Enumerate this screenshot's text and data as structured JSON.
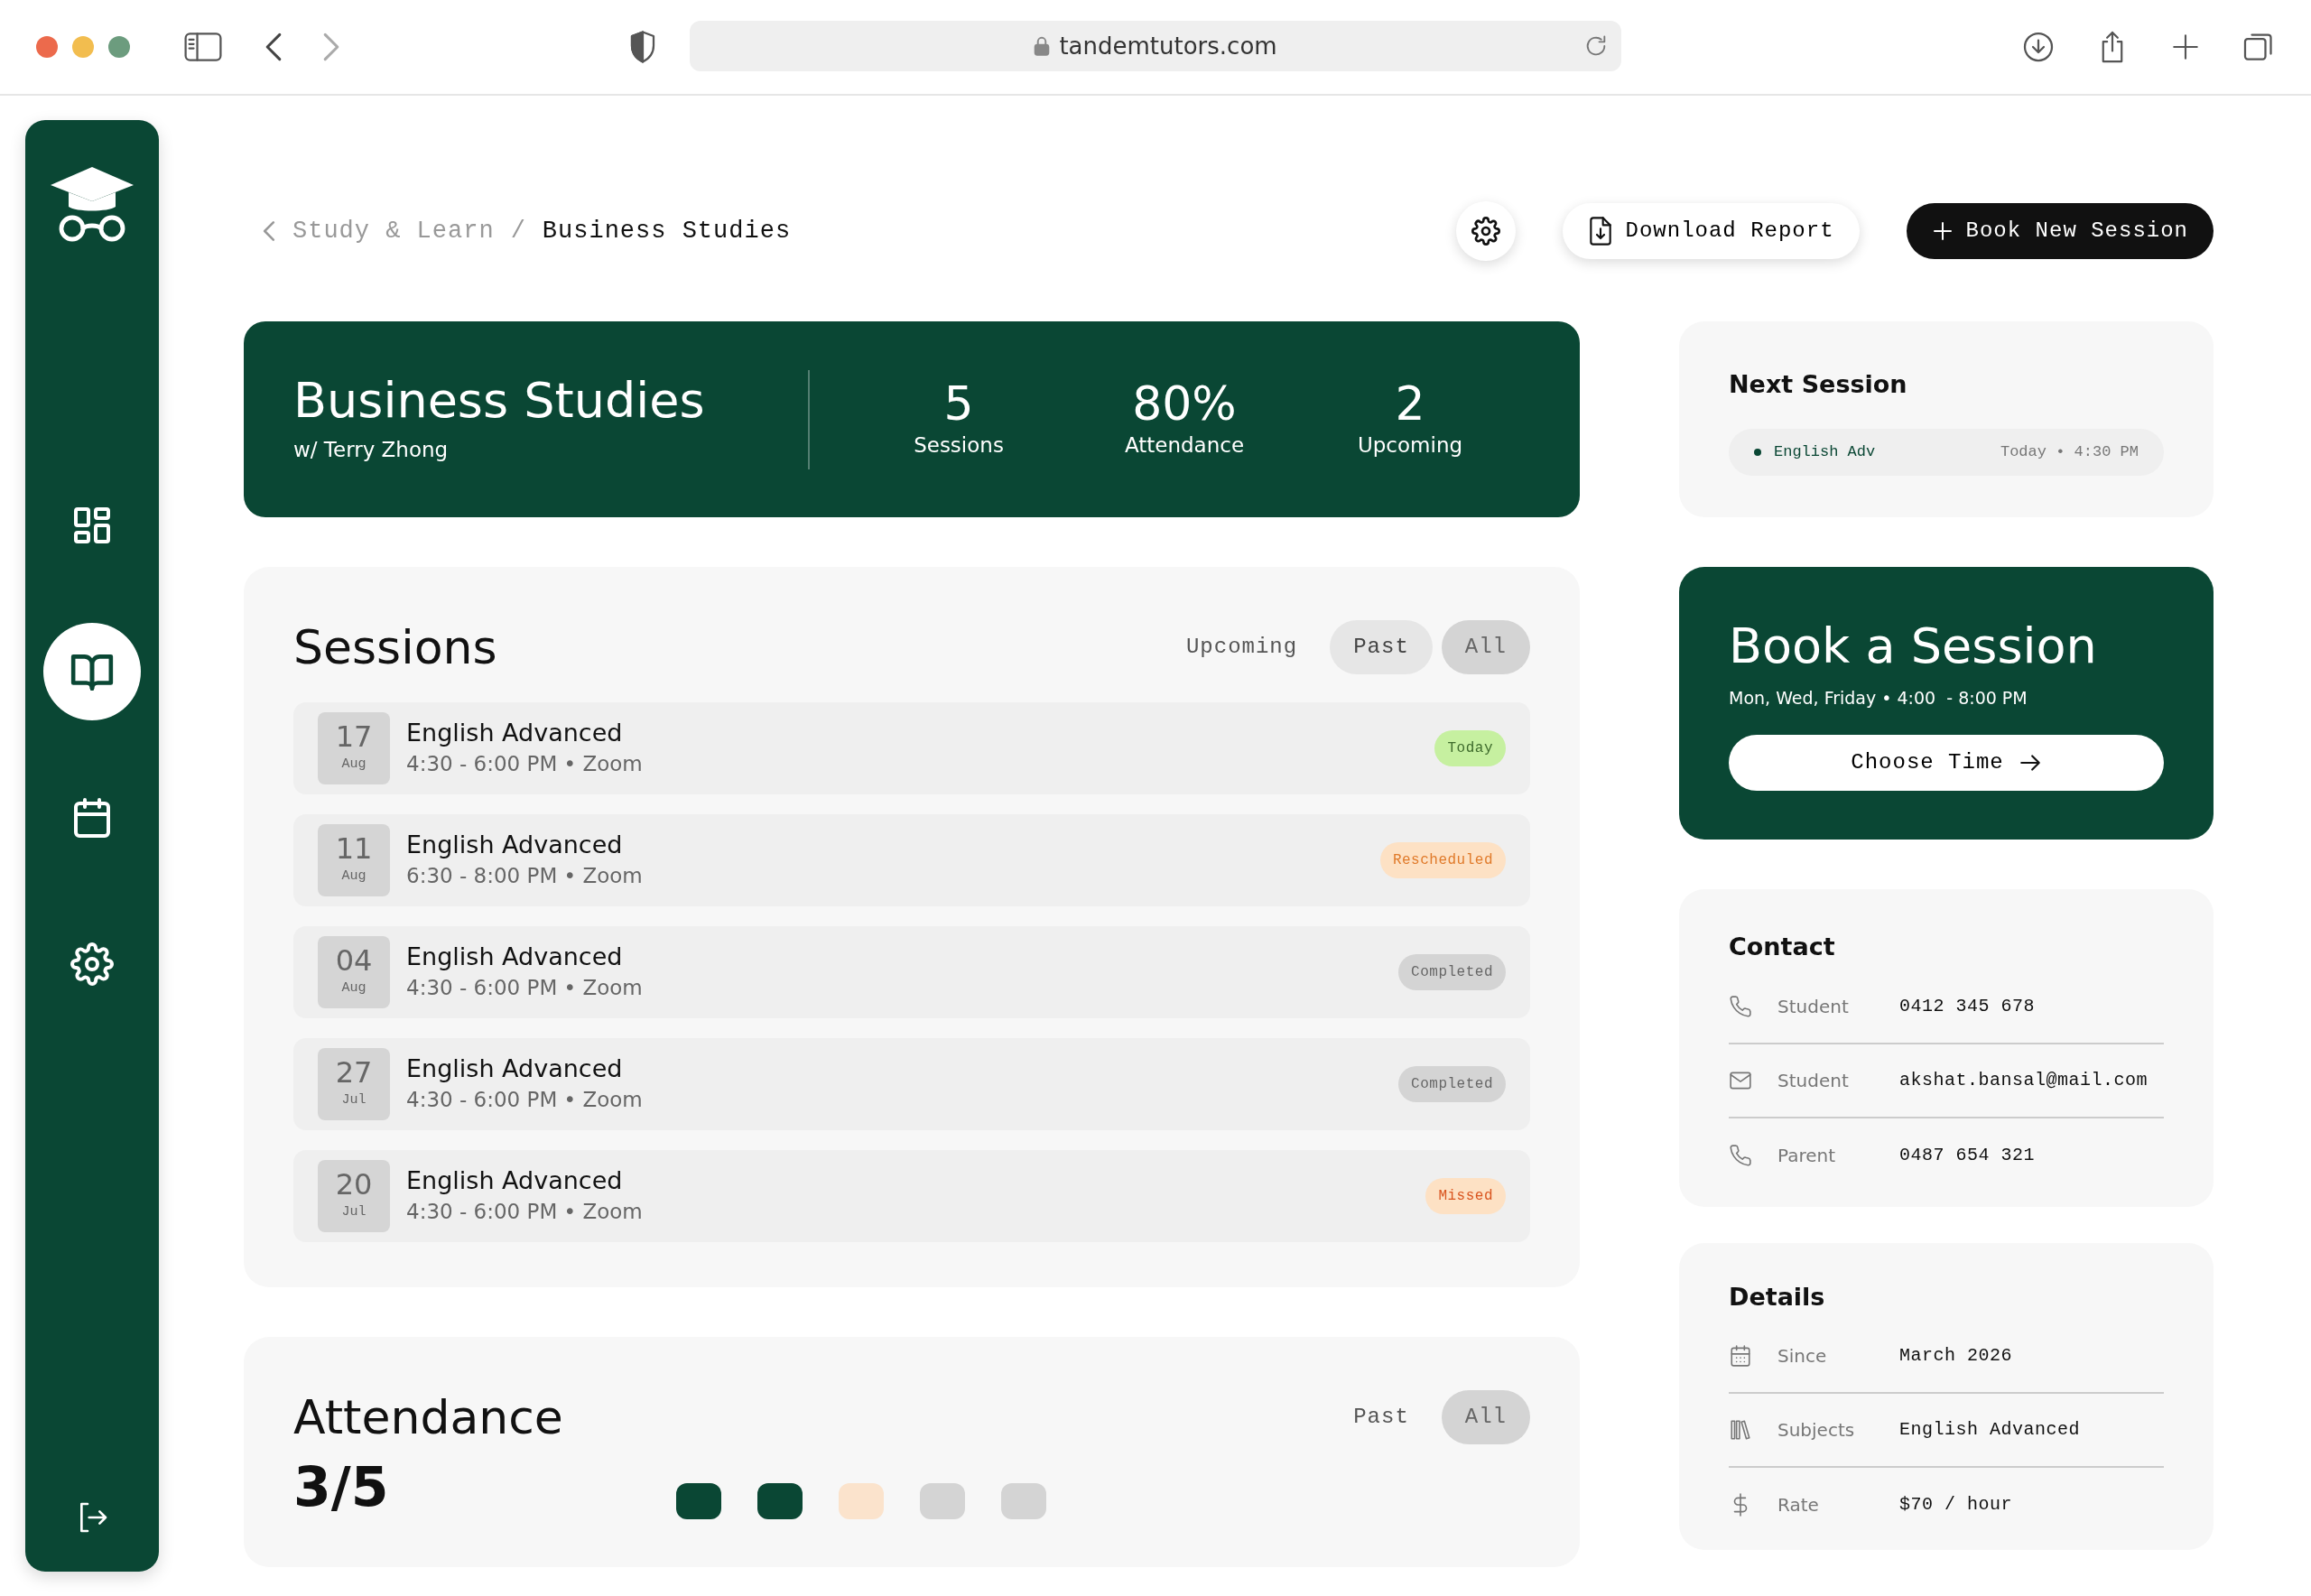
{
  "browser": {
    "url": "tandemtutors.com"
  },
  "sidebar": {
    "items": [
      {
        "kind": "dashboard",
        "selected": false
      },
      {
        "kind": "book",
        "selected": true
      },
      {
        "kind": "calendar",
        "selected": false
      },
      {
        "kind": "settings",
        "selected": false
      }
    ]
  },
  "breadcrumb": {
    "parent": "Study & Learn",
    "separator": "/",
    "current": "Business Studies"
  },
  "actions": {
    "download": "Download Report",
    "book": "Book New Session"
  },
  "hero": {
    "title": "Business Studies",
    "subtitle": "w/ Terry Zhong",
    "stats": [
      {
        "value": "5",
        "label": "Sessions"
      },
      {
        "value": "80%",
        "label": "Attendance"
      },
      {
        "value": "2",
        "label": "Upcoming"
      }
    ]
  },
  "sessions": {
    "title": "Sessions",
    "filters": [
      {
        "label": "Upcoming",
        "selected": false,
        "hover": false
      },
      {
        "label": "Past",
        "selected": false,
        "hover": true
      },
      {
        "label": "All",
        "selected": true,
        "hover": false
      }
    ],
    "items": [
      {
        "day": "17",
        "month": "Aug",
        "title": "English Advanced",
        "detail": "4:30 - 6:00 PM • Zoom",
        "status": "Today",
        "kind": "today"
      },
      {
        "day": "11",
        "month": "Aug",
        "title": "English Advanced",
        "detail": "6:30 - 8:00 PM • Zoom",
        "status": "Rescheduled",
        "kind": "rescheduled"
      },
      {
        "day": "04",
        "month": "Aug",
        "title": "English Advanced",
        "detail": "4:30 - 6:00 PM • Zoom",
        "status": "Completed",
        "kind": "completed"
      },
      {
        "day": "27",
        "month": "Jul",
        "title": "English Advanced",
        "detail": "4:30 - 6:00 PM • Zoom",
        "status": "Completed",
        "kind": "completed"
      },
      {
        "day": "20",
        "month": "Jul",
        "title": "English Advanced",
        "detail": "4:30 - 6:00 PM • Zoom",
        "status": "Missed",
        "kind": "missed"
      }
    ]
  },
  "attendance": {
    "title": "Attendance",
    "filters": [
      {
        "label": "Past",
        "selected": false
      },
      {
        "label": "All",
        "selected": true
      }
    ],
    "score": "3/5",
    "marks": [
      {
        "color": "#0a4734"
      },
      {
        "color": "#0a4734"
      },
      {
        "color": "#fbe3cc"
      },
      {
        "color": "#d4d4d4"
      },
      {
        "color": "#d4d4d4"
      }
    ]
  },
  "next_session": {
    "title": "Next Session",
    "subject": "English Adv",
    "time": "Today • 4:30 PM"
  },
  "book_card": {
    "title": "Book a Session",
    "hours": "Mon, Wed, Friday • 4:00  - 8:00 PM",
    "button": "Choose Time"
  },
  "contact": {
    "title": "Contact",
    "rows": [
      {
        "kind": "phone",
        "label": "Student",
        "value": "0412 345 678"
      },
      {
        "kind": "email",
        "label": "Student",
        "value": "akshat.bansal@mail.com"
      },
      {
        "kind": "phone",
        "label": "Parent",
        "value": "0487 654 321"
      }
    ]
  },
  "details": {
    "title": "Details",
    "rows": [
      {
        "kind": "calendar",
        "label": "Since",
        "value": "March 2026"
      },
      {
        "kind": "books",
        "label": "Subjects",
        "value": "English Advanced"
      },
      {
        "kind": "dollar",
        "label": "Rate",
        "value": "$70 / hour"
      }
    ]
  }
}
